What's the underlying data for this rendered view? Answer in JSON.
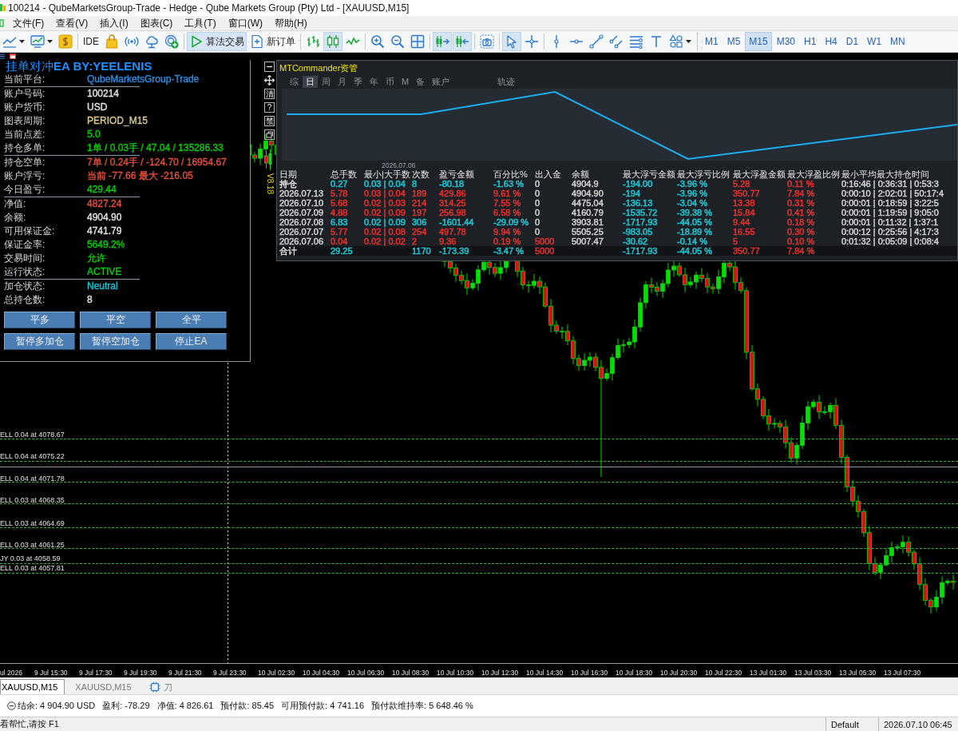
{
  "window": {
    "title": "100214 - QubeMarketsGroup-Trade - Hedge - Qube Markets Group (Pty) Ltd - [XAUUSD,M15]"
  },
  "menu": [
    "文件(F)",
    "查看(V)",
    "插入(I)",
    "图表(C)",
    "工具(T)",
    "窗口(W)",
    "帮助(H)"
  ],
  "toolbar": {
    "groups": [
      [
        {
          "kind": "icon_menu",
          "selected": false
        },
        {
          "kind": "icon_menu",
          "selected": false
        },
        {
          "kind": "icon",
          "selected": false
        }
      ],
      [
        {
          "kind": "text",
          "label": "IDE",
          "selected": false
        },
        {
          "kind": "icon",
          "selected": false
        },
        {
          "kind": "icon",
          "selected": false
        },
        {
          "kind": "icon",
          "selected": false
        },
        {
          "kind": "icon",
          "selected": false
        }
      ],
      [
        {
          "kind": "icon_text",
          "label": "算法交易",
          "selected": true
        },
        {
          "kind": "icon_text",
          "label": "新订单",
          "selected": false
        }
      ],
      [
        {
          "kind": "icon",
          "selected": false
        },
        {
          "kind": "icon",
          "selected": true
        },
        {
          "kind": "icon",
          "selected": false
        }
      ],
      [
        {
          "kind": "icon",
          "selected": false
        },
        {
          "kind": "icon",
          "selected": false
        },
        {
          "kind": "icon",
          "selected": false
        }
      ],
      [
        {
          "kind": "icon",
          "selected": true
        },
        {
          "kind": "icon",
          "selected": true
        }
      ],
      [
        {
          "kind": "icon",
          "selected": false
        }
      ],
      [
        {
          "kind": "icon",
          "selected": true
        },
        {
          "kind": "icon",
          "selected": false
        }
      ],
      [
        {
          "kind": "icon",
          "selected": false
        },
        {
          "kind": "icon",
          "selected": false
        },
        {
          "kind": "icon",
          "selected": false
        },
        {
          "kind": "icon",
          "selected": false
        },
        {
          "kind": "icon",
          "selected": false
        },
        {
          "kind": "icon",
          "selected": false
        },
        {
          "kind": "icon_menu",
          "selected": false
        }
      ]
    ],
    "timeframes": [
      {
        "label": "M1",
        "selected": false
      },
      {
        "label": "M5",
        "selected": false
      },
      {
        "label": "M15",
        "selected": true
      },
      {
        "label": "M30",
        "selected": false
      },
      {
        "label": "H1",
        "selected": false
      },
      {
        "label": "H4",
        "selected": false
      },
      {
        "label": "D1",
        "selected": false
      },
      {
        "label": "W1",
        "selected": false
      },
      {
        "label": "MN",
        "selected": false
      }
    ]
  },
  "ea_panel": {
    "title": "挂单对冲**EA BY:YEELENIS**",
    "sections": [
      [
        {
          "label": "当前平台:",
          "value": "QubeMarketsGroup-Trade",
          "color": "#2a8fe6"
        }
      ],
      [
        {
          "label": "账户号码:",
          "value": "100214",
          "color": "#e4e4e4"
        },
        {
          "label": "账户货币:",
          "value": "USD",
          "color": "#e4e4e4"
        },
        {
          "label": "图表周期:",
          "value": "PERIOD_M15",
          "color": "#d9c98c"
        },
        {
          "label": "当前点差:",
          "value": "5.0",
          "color": "#00d200"
        },
        {
          "label": "持仓多单:",
          "value": "1单 / 0.03手 / 47.04 / 135286.33",
          "color": "#00d200"
        }
      ],
      [
        {
          "label": "持仓空单:",
          "value": "7单 / 0.24手 / -124.70 / 16954.67",
          "color": "#e8503a"
        },
        {
          "label": "账户浮亏:",
          "value": "当前 -77.66 最大 -216.05",
          "color": "#e8503a"
        },
        {
          "label": "今日盈亏:",
          "value": "429.44",
          "color": "#00d200"
        }
      ],
      [
        {
          "label": "净值:",
          "value": "4827.24",
          "color": "#e8503a"
        },
        {
          "label": "余额:",
          "value": "4904.90",
          "color": "#e4e4e4"
        },
        {
          "label": "可用保证金:",
          "value": "4741.79",
          "color": "#e4e4e4"
        },
        {
          "label": "保证金率:",
          "value": "5649.2%",
          "color": "#00d200"
        },
        {
          "label": "交易时间:",
          "value": "允许",
          "color": "#00d200"
        },
        {
          "label": "运行状态:",
          "value": "ACTIVE",
          "color": "#00d200"
        }
      ],
      [
        {
          "label": "加仓状态:",
          "value": "Neutral",
          "color": "#00c8dc"
        },
        {
          "label": "总持仓数:",
          "value": "8",
          "color": "#e4e4e4"
        }
      ]
    ],
    "button_rows": [
      [
        "平多",
        "平空",
        "全平"
      ],
      [
        "暂停多加仓",
        "暂停空加仓",
        "停止EA"
      ]
    ]
  },
  "commander": {
    "side_buttons": [
      {
        "kind": "icon"
      },
      {
        "kind": "icon"
      },
      {
        "kind": "text",
        "label": "清"
      },
      {
        "kind": "text",
        "label": "?"
      },
      {
        "kind": "text",
        "label": "禁"
      },
      {
        "kind": "icon"
      }
    ],
    "version": "V8.18",
    "title": "MTCommander资管",
    "tab_groups": [
      [
        {
          "label": "综",
          "selected": false
        },
        {
          "label": "日",
          "selected": true
        },
        {
          "label": "周",
          "selected": false
        },
        {
          "label": "月",
          "selected": false
        },
        {
          "label": "季",
          "selected": false
        },
        {
          "label": "年",
          "selected": false
        },
        {
          "label": "币",
          "selected": false
        },
        {
          "label": "M",
          "selected": false
        },
        {
          "label": "备",
          "selected": false
        },
        {
          "label": "账户",
          "selected": false
        }
      ],
      [
        {
          "label": "轨迹",
          "selected": false
        }
      ]
    ],
    "chart_date": "2026.07.06",
    "table": {
      "columns": [
        "日期",
        "总手数",
        "最小|大手数",
        "次数",
        "盈亏金额",
        "百分比%",
        "出入金",
        "余额",
        "最大浮亏金额",
        "最大浮亏比例",
        "最大浮盈金额",
        "最大浮盈比例",
        "最小平均最大持仓时间"
      ],
      "rows": [
        {
          "kind": "data",
          "cells": [
            {
              "text": "持仓",
              "color": "#dcdcdc"
            },
            {
              "text": "0.27",
              "color": "#1fc8d6"
            },
            {
              "text": "0.03 | 0.04",
              "color": "#1fc8d6"
            },
            {
              "text": "8",
              "color": "#1fc8d6"
            },
            {
              "text": "-80.18",
              "color": "#1fc8d6"
            },
            {
              "text": "-1.63 %",
              "color": "#1fc8d6"
            },
            {
              "text": "0",
              "color": "#cfcfcf"
            },
            {
              "text": "4904.9",
              "color": "#cfcfcf"
            },
            {
              "text": "-194.00",
              "color": "#1fc8d6"
            },
            {
              "text": "-3.96 %",
              "color": "#1fc8d6"
            },
            {
              "text": "5.28",
              "color": "#e8302c"
            },
            {
              "text": "0.11 %",
              "color": "#e8302c"
            },
            {
              "text": "0:16:46 | 0:36:31 | 0:53:3",
              "color": "#cfcfcf"
            }
          ]
        },
        {
          "kind": "data",
          "cells": [
            {
              "text": "2026.07.13",
              "color": "#cfcfcf"
            },
            {
              "text": "5.78",
              "color": "#e8302c"
            },
            {
              "text": "0.03 | 0.04",
              "color": "#e8302c"
            },
            {
              "text": "189",
              "color": "#e8302c"
            },
            {
              "text": "429.86",
              "color": "#e8302c"
            },
            {
              "text": "9.61 %",
              "color": "#e8302c"
            },
            {
              "text": "0",
              "color": "#cfcfcf"
            },
            {
              "text": "4904.90",
              "color": "#cfcfcf"
            },
            {
              "text": "-194",
              "color": "#1fc8d6"
            },
            {
              "text": "-3.96 %",
              "color": "#1fc8d6"
            },
            {
              "text": "350.77",
              "color": "#e8302c"
            },
            {
              "text": "7.84 %",
              "color": "#e8302c"
            },
            {
              "text": "0:00:10 | 2:02:01 | 50:17:4",
              "color": "#cfcfcf"
            }
          ]
        },
        {
          "kind": "data",
          "cells": [
            {
              "text": "2026.07.10",
              "color": "#cfcfcf"
            },
            {
              "text": "5.68",
              "color": "#e8302c"
            },
            {
              "text": "0.02 | 0.03",
              "color": "#e8302c"
            },
            {
              "text": "214",
              "color": "#e8302c"
            },
            {
              "text": "314.25",
              "color": "#e8302c"
            },
            {
              "text": "7.55 %",
              "color": "#e8302c"
            },
            {
              "text": "0",
              "color": "#cfcfcf"
            },
            {
              "text": "4475.04",
              "color": "#cfcfcf"
            },
            {
              "text": "-136.13",
              "color": "#1fc8d6"
            },
            {
              "text": "-3.04 %",
              "color": "#1fc8d6"
            },
            {
              "text": "13.38",
              "color": "#e8302c"
            },
            {
              "text": "0.31 %",
              "color": "#e8302c"
            },
            {
              "text": "0:00:01 | 0:18:59 | 3:22:5",
              "color": "#cfcfcf"
            }
          ]
        },
        {
          "kind": "data",
          "cells": [
            {
              "text": "2026.07.09",
              "color": "#cfcfcf"
            },
            {
              "text": "4.88",
              "color": "#e8302c"
            },
            {
              "text": "0.02 | 0.09",
              "color": "#e8302c"
            },
            {
              "text": "197",
              "color": "#e8302c"
            },
            {
              "text": "256.98",
              "color": "#e8302c"
            },
            {
              "text": "6.58 %",
              "color": "#e8302c"
            },
            {
              "text": "0",
              "color": "#cfcfcf"
            },
            {
              "text": "4160.79",
              "color": "#cfcfcf"
            },
            {
              "text": "-1535.72",
              "color": "#1fc8d6"
            },
            {
              "text": "-39.38 %",
              "color": "#1fc8d6"
            },
            {
              "text": "15.84",
              "color": "#e8302c"
            },
            {
              "text": "0.41 %",
              "color": "#e8302c"
            },
            {
              "text": "0:00:01 | 1:19:59 | 9:05:0",
              "color": "#cfcfcf"
            }
          ]
        },
        {
          "kind": "data",
          "cells": [
            {
              "text": "2026.07.08",
              "color": "#cfcfcf"
            },
            {
              "text": "6.83",
              "color": "#1fc8d6"
            },
            {
              "text": "0.02 | 0.09",
              "color": "#1fc8d6"
            },
            {
              "text": "306",
              "color": "#1fc8d6"
            },
            {
              "text": "-1601.44",
              "color": "#1fc8d6"
            },
            {
              "text": "-29.09 %",
              "color": "#1fc8d6"
            },
            {
              "text": "0",
              "color": "#cfcfcf"
            },
            {
              "text": "3903.81",
              "color": "#cfcfcf"
            },
            {
              "text": "-1717.93",
              "color": "#1fc8d6"
            },
            {
              "text": "-44.05 %",
              "color": "#1fc8d6"
            },
            {
              "text": "9.44",
              "color": "#e8302c"
            },
            {
              "text": "0.18 %",
              "color": "#e8302c"
            },
            {
              "text": "0:00:01 | 0:11:32 | 1:37:1",
              "color": "#cfcfcf"
            }
          ]
        },
        {
          "kind": "data",
          "cells": [
            {
              "text": "2026.07.07",
              "color": "#cfcfcf"
            },
            {
              "text": "5.77",
              "color": "#e8302c"
            },
            {
              "text": "0.02 | 0.08",
              "color": "#e8302c"
            },
            {
              "text": "254",
              "color": "#e8302c"
            },
            {
              "text": "497.78",
              "color": "#e8302c"
            },
            {
              "text": "9.94 %",
              "color": "#e8302c"
            },
            {
              "text": "0",
              "color": "#cfcfcf"
            },
            {
              "text": "5505.25",
              "color": "#cfcfcf"
            },
            {
              "text": "-983.05",
              "color": "#1fc8d6"
            },
            {
              "text": "-18.89 %",
              "color": "#1fc8d6"
            },
            {
              "text": "16.55",
              "color": "#e8302c"
            },
            {
              "text": "0.30 %",
              "color": "#e8302c"
            },
            {
              "text": "0:00:12 | 0:25:56 | 4:17:3",
              "color": "#cfcfcf"
            }
          ]
        },
        {
          "kind": "data",
          "cells": [
            {
              "text": "2026.07.06",
              "color": "#cfcfcf"
            },
            {
              "text": "0.04",
              "color": "#e8302c"
            },
            {
              "text": "0.02 | 0.02",
              "color": "#e8302c"
            },
            {
              "text": "2",
              "color": "#e8302c"
            },
            {
              "text": "9.36",
              "color": "#e8302c"
            },
            {
              "text": "0.19 %",
              "color": "#e8302c"
            },
            {
              "text": "5000",
              "color": "#e8302c"
            },
            {
              "text": "5007.47",
              "color": "#cfcfcf"
            },
            {
              "text": "-30.62",
              "color": "#1fc8d6"
            },
            {
              "text": "-0.14 %",
              "color": "#1fc8d6"
            },
            {
              "text": "5",
              "color": "#e8302c"
            },
            {
              "text": "0.10 %",
              "color": "#e8302c"
            },
            {
              "text": "0:01:32 | 0:05:09 | 0:08:4",
              "color": "#cfcfcf"
            }
          ]
        },
        {
          "kind": "summary",
          "cells": [
            {
              "text": "合计",
              "color": "#dcdcdc"
            },
            {
              "text": "29.25",
              "color": "#1fc8d6"
            },
            null,
            {
              "text": "1170",
              "color": "#1fc8d6"
            },
            {
              "text": "-173.39",
              "color": "#1fc8d6"
            },
            {
              "text": "-3.47 %",
              "color": "#1fc8d6"
            },
            {
              "text": "5000",
              "color": "#e8302c"
            },
            null,
            {
              "text": "-1717.93",
              "color": "#1fc8d6"
            },
            {
              "text": "-44.05 %",
              "color": "#1fc8d6"
            },
            {
              "text": "350.77",
              "color": "#e8302c"
            },
            {
              "text": "7.84 %",
              "color": "#e8302c"
            },
            null
          ]
        }
      ]
    }
  },
  "chart": {
    "order_lines": [
      {
        "label": "ELL 0.04 at 4078.67"
      },
      {
        "label": "ELL 0.04 at 4075.22"
      },
      {
        "label": "ELL 0.04 at 4071.78"
      },
      {
        "label": "ELL 0.03 at 4068.35"
      },
      {
        "label": "ELL 0.03 at 4064.69"
      },
      {
        "label": "ELL 0.03 at 4061.25"
      },
      {
        "label": "JY 0.03 at 4058.59"
      },
      {
        "label": "ELL 0.03 at 4057.81"
      }
    ],
    "time_axis": [
      "ul 2026",
      "9 Jul 15:30",
      "9 Jul 17:30",
      "9 Jul 19:30",
      "9 Jul 21:30",
      "9 Jul 23:30",
      "10 Jul 02:30",
      "10 Jul 04:30",
      "10 Jul 06:30",
      "10 Jul 08:30",
      "10 Jul 10:30",
      "10 Jul 12:30",
      "10 Jul 14:30",
      "10 Jul 16:30",
      "10 Jul 18:30",
      "10 Jul 20:30",
      "10 Jul 22:30",
      "13 Jul 01:30",
      "13 Jul 03:30",
      "13 Jul 05:30",
      "13 Jul 07:30"
    ]
  },
  "chart_tabs": [
    {
      "kind": "chart",
      "label": "XAUUSD,M15",
      "selected": true
    },
    {
      "kind": "chart",
      "label": "XAUUSD,M15",
      "selected": false
    },
    {
      "kind": "robot",
      "label": "刀",
      "selected": false
    }
  ],
  "account": {
    "items": [
      "结余: 4 904.90 USD",
      "盈利: -78.29",
      "净值: 4 826.61",
      "预付款: 85.45",
      "可用预付款: 4 741.16",
      "预付款维持率: 5 648.46 %"
    ]
  },
  "status_bar": {
    "help": "看帮忙,请按 F1",
    "profile": "Default",
    "datetime": "2026.07.10 06:45"
  }
}
